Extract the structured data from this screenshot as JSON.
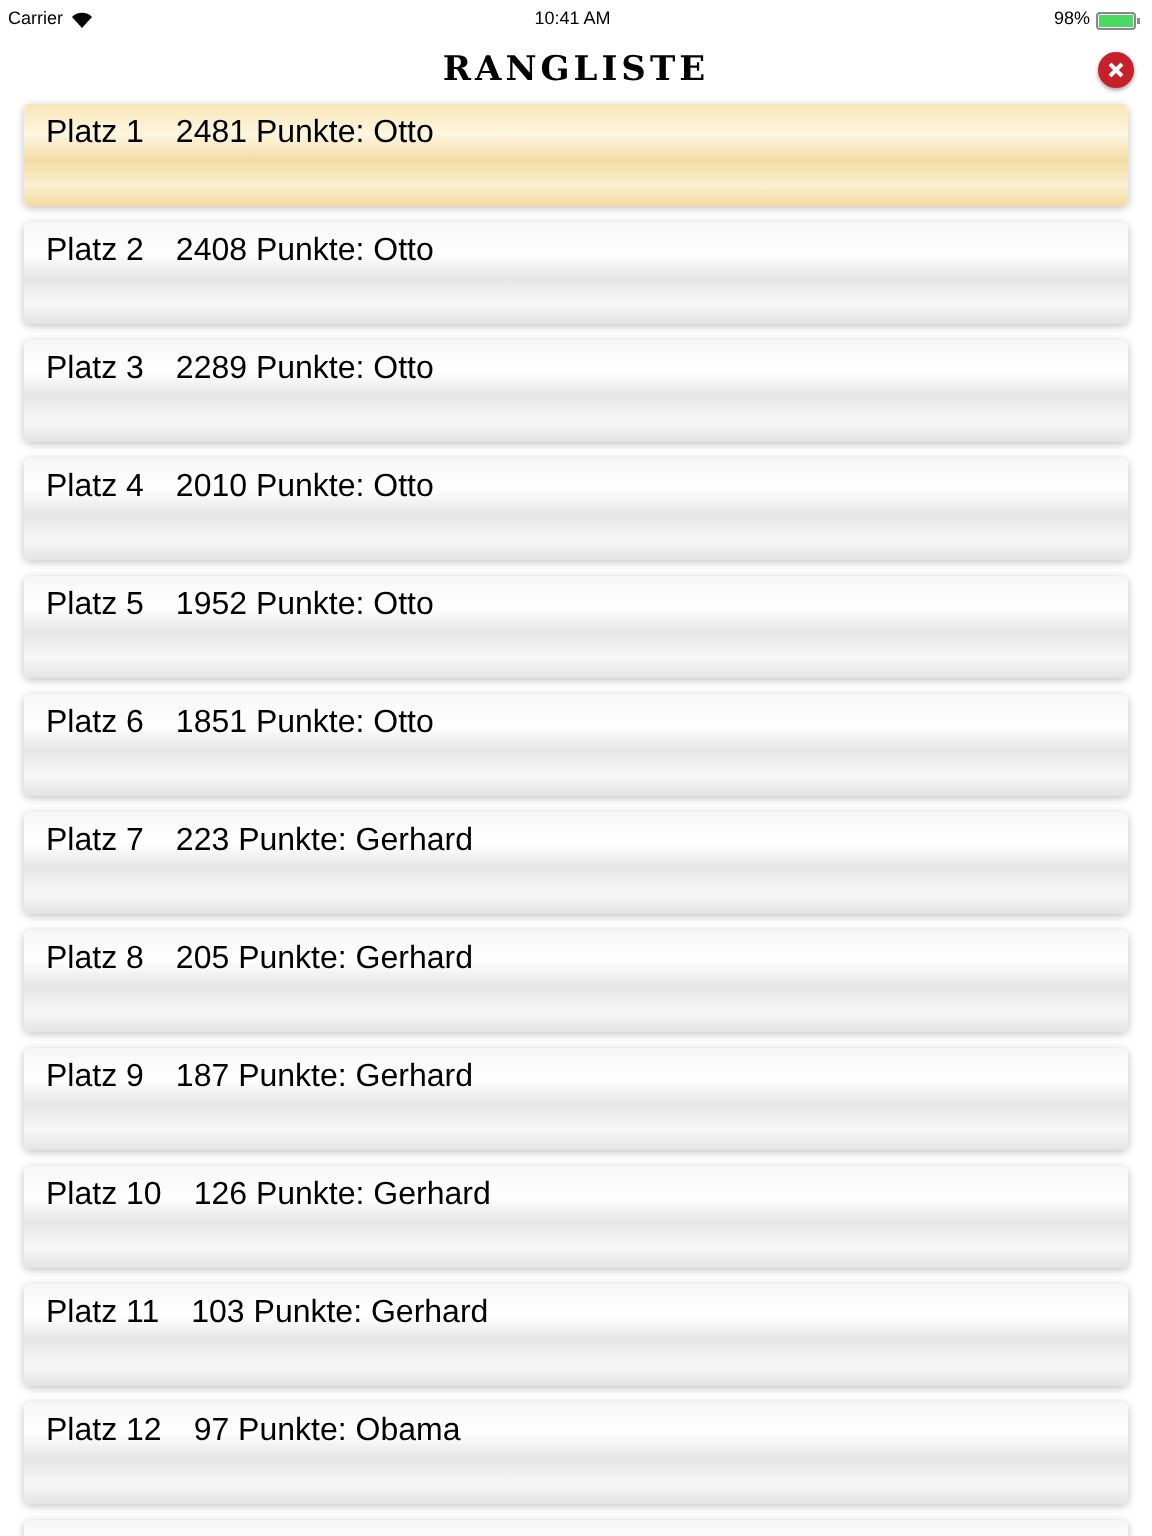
{
  "status_bar": {
    "carrier": "Carrier",
    "time": "10:41 AM",
    "battery": "98%"
  },
  "title": "RANGLISTE",
  "rows": [
    {
      "rank": "Platz 1",
      "score": "2481 Punkte: Otto",
      "kind": "gold"
    },
    {
      "rank": "Platz 2",
      "score": "2408 Punkte: Otto",
      "kind": "plain"
    },
    {
      "rank": "Platz 3",
      "score": "2289 Punkte: Otto",
      "kind": "plain"
    },
    {
      "rank": "Platz 4",
      "score": "2010 Punkte: Otto",
      "kind": "plain"
    },
    {
      "rank": "Platz 5",
      "score": "1952 Punkte: Otto",
      "kind": "plain"
    },
    {
      "rank": "Platz 6",
      "score": "1851 Punkte: Otto",
      "kind": "plain"
    },
    {
      "rank": "Platz 7",
      "score": "223 Punkte: Gerhard",
      "kind": "plain"
    },
    {
      "rank": "Platz 8",
      "score": "205 Punkte: Gerhard",
      "kind": "plain"
    },
    {
      "rank": "Platz 9",
      "score": "187 Punkte: Gerhard",
      "kind": "plain"
    },
    {
      "rank": "Platz 10",
      "score": "126 Punkte: Gerhard",
      "kind": "plain"
    },
    {
      "rank": "Platz 11",
      "score": "103 Punkte: Gerhard",
      "kind": "plain"
    },
    {
      "rank": "Platz 12",
      "score": "97 Punkte: Obama",
      "kind": "plain"
    }
  ]
}
